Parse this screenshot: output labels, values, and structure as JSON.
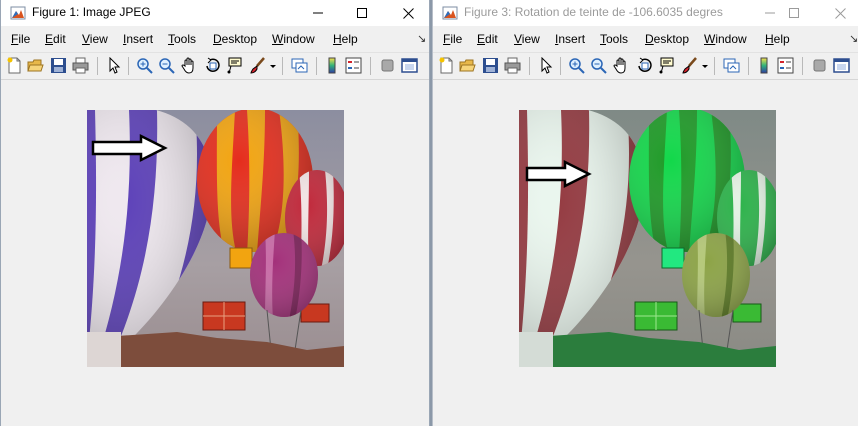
{
  "windows": [
    {
      "title": "Figure 1: Image JPEG",
      "title_color": "#000000",
      "menu": [
        "File",
        "Edit",
        "View",
        "Insert",
        "Tools",
        "Desktop",
        "Window",
        "Help"
      ],
      "toolbar_icons": [
        "new-figure-icon",
        "open-file-icon",
        "save-icon",
        "print-icon",
        "pointer-icon",
        "zoom-in-icon",
        "zoom-out-icon",
        "pan-hand-icon",
        "rotate-3d-icon",
        "data-cursor-icon",
        "brush-icon",
        "link-plot-icon",
        "colorbar-icon",
        "legend-icon",
        "hide-plot-tools-icon",
        "show-plot-tools-icon"
      ],
      "image": "hot-air balloons photo, original colors",
      "palette": {
        "balloon_stripe": "#5b3fb8",
        "balloon_light": "#efe8ef",
        "right_balloon_a": "#e52d1c",
        "right_balloon_b": "#f2a410",
        "small_balloon": "#a3307a",
        "basket": "#c83820",
        "ground": "#7d4d3c",
        "sky": "#9a96a0"
      }
    },
    {
      "title": "Figure 3: Rotation de teinte de -106.6035 degres",
      "title_color": "#9b9b9b",
      "menu": [
        "File",
        "Edit",
        "View",
        "Insert",
        "Tools",
        "Desktop",
        "Window",
        "Help"
      ],
      "toolbar_icons": [
        "new-figure-icon",
        "open-file-icon",
        "save-icon",
        "print-icon",
        "pointer-icon",
        "zoom-in-icon",
        "zoom-out-icon",
        "pan-hand-icon",
        "rotate-3d-icon",
        "data-cursor-icon",
        "brush-icon",
        "link-plot-icon",
        "colorbar-icon",
        "legend-icon",
        "hide-plot-tools-icon",
        "show-plot-tools-icon"
      ],
      "image": "hot-air balloons photo, hue rotated",
      "palette": {
        "balloon_stripe": "#93383f",
        "balloon_light": "#eaf6ee",
        "right_balloon_a": "#12d84a",
        "right_balloon_b": "#1d9a26",
        "small_balloon": "#8ca346",
        "basket": "#3aba34",
        "ground": "#2b7d3d",
        "sky": "#8a8e8e"
      }
    }
  ]
}
